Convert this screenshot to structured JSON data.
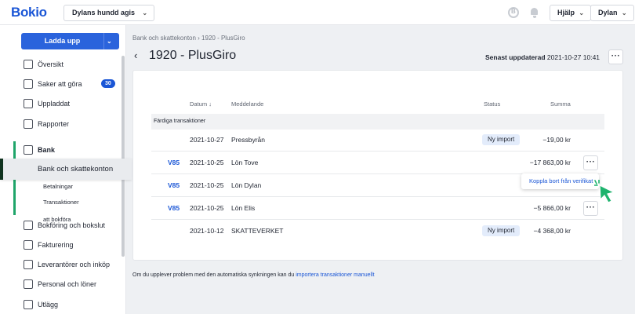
{
  "header": {
    "logo": "Bokio",
    "company": "Dylans hundd agis",
    "help_label": "Hjälp",
    "user_label": "Dylan"
  },
  "sidebar": {
    "upload_label": "Ladda upp",
    "items": [
      {
        "label": "Översikt",
        "icon": "home-icon"
      },
      {
        "label": "Saker att göra",
        "icon": "checklist-icon",
        "badge": "30"
      },
      {
        "label": "Uppladdat",
        "icon": "folder-icon"
      },
      {
        "label": "Rapporter",
        "icon": "chart-icon"
      },
      {
        "label": "Bank",
        "icon": "bank-icon"
      },
      {
        "label": "Bokföring och bokslut",
        "icon": "ledger-icon"
      },
      {
        "label": "Fakturering",
        "icon": "invoice-icon"
      },
      {
        "label": "Leverantörer och inköp",
        "icon": "supplier-icon"
      },
      {
        "label": "Personal och löner",
        "icon": "people-icon"
      },
      {
        "label": "Utlägg",
        "icon": "card-icon"
      }
    ],
    "bank_sub": {
      "active": "Bank och skattekonton",
      "items": [
        "Betalningar",
        "Transaktioner att bokföra"
      ]
    }
  },
  "main": {
    "breadcrumb": "Bank och skattekonton  ›  1920 - PlusGiro",
    "title": "1920 - PlusGiro",
    "updated_label": "Senast uppdaterad",
    "updated_value": "2021-10-27 10:41",
    "table": {
      "headers": {
        "date": "Datum",
        "message": "Meddelande",
        "status": "Status",
        "sum": "Summa"
      },
      "group_label": "Färdiga transaktioner",
      "rows": [
        {
          "ver": "",
          "date": "2021-10-27",
          "message": "Pressbyrån",
          "status": "Ny import",
          "sum": "−19,00 kr"
        },
        {
          "ver": "V85",
          "date": "2021-10-25",
          "message": "Lön Tove",
          "status": "",
          "sum": "−17 863,00 kr"
        },
        {
          "ver": "V85",
          "date": "2021-10-25",
          "message": "Lön Dylan",
          "status": "",
          "sum": ""
        },
        {
          "ver": "V85",
          "date": "2021-10-25",
          "message": "Lön Elis",
          "status": "",
          "sum": "−5 866,00 kr"
        },
        {
          "ver": "",
          "date": "2021-10-12",
          "message": "SKATTEVERKET",
          "status": "Ny import",
          "sum": "−4 368,00 kr"
        }
      ]
    },
    "context_menu_item": "Koppla bort från verifikat",
    "footer_text": "Om du upplever problem med den automatiska synkningen kan du ",
    "footer_link": "importera transaktioner manuellt"
  },
  "colors": {
    "brand": "#1a56d6",
    "button": "#2a63dc",
    "bank_accent": "#1fa56a",
    "cursor": "#1fb36e",
    "status_bg": "#e3ecfb"
  }
}
